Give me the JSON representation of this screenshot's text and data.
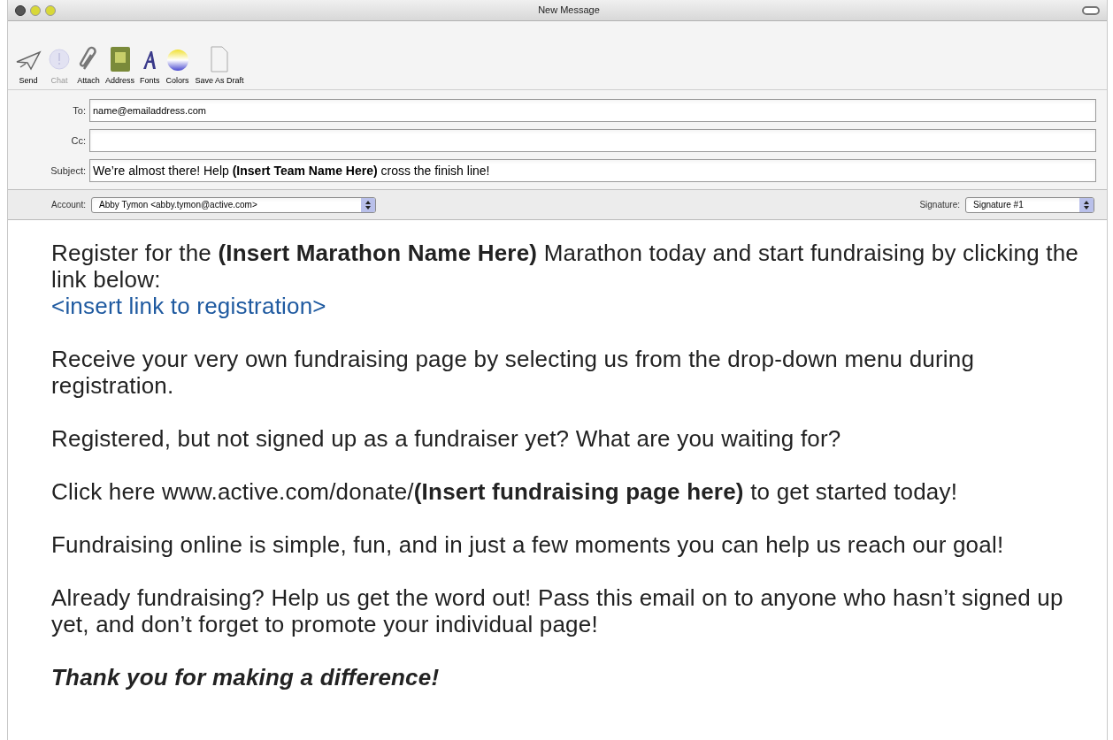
{
  "window": {
    "title": "New Message"
  },
  "toolbar": [
    {
      "label": "Send",
      "kind": "send",
      "disabled": false
    },
    {
      "label": "Chat",
      "kind": "chat",
      "disabled": true
    },
    {
      "label": "Attach",
      "kind": "attach",
      "disabled": false
    },
    {
      "label": "Address",
      "kind": "address",
      "disabled": false
    },
    {
      "label": "Fonts",
      "kind": "fonts",
      "disabled": false
    },
    {
      "label": "Colors",
      "kind": "colors",
      "disabled": false
    },
    {
      "label": "Save As Draft",
      "kind": "draft",
      "disabled": false
    }
  ],
  "fields": [
    {
      "label": "To:",
      "value": "name@emailaddress.com",
      "kind": "address"
    },
    {
      "label": "Cc:",
      "kind": "address"
    },
    {
      "label": "Subject:",
      "value": "We’re almost there! Help **(Insert Team Name Here)** cross the finish line!",
      "kind": "subject"
    }
  ],
  "account": {
    "label": "Account:",
    "value": "Abby Tymon <abby.tymon@active.com>"
  },
  "signature": {
    "label": "Signature:",
    "value": "Signature #1"
  },
  "body": [
    {
      "kind": "text",
      "text": "Register for the **(Insert Marathon Name Here)** Marathon today and start fundraising by clicking the link below:"
    },
    {
      "kind": "link",
      "text": "<insert link to registration>"
    },
    {
      "kind": "text",
      "text": "Receive your very own fundraising page by selecting us from the drop-down menu during registration."
    },
    {
      "kind": "text",
      "text": "Registered, but not signed up as a fundraiser yet? What are you waiting for?"
    },
    {
      "kind": "text",
      "text": "Click here www.active.com/donate/**(Insert fundraising page here)** to get started today!"
    },
    {
      "kind": "text",
      "text": "Fundraising online is simple, fun, and in just a few moments you can help us reach our goal!"
    },
    {
      "kind": "text",
      "text": "Already fundraising? Help us get the word out! Pass this email on to anyone who hasn’t signed up yet, and don’t forget to promote your individual page!"
    },
    {
      "kind": "closing",
      "text": "Thank you for making a difference!"
    }
  ]
}
